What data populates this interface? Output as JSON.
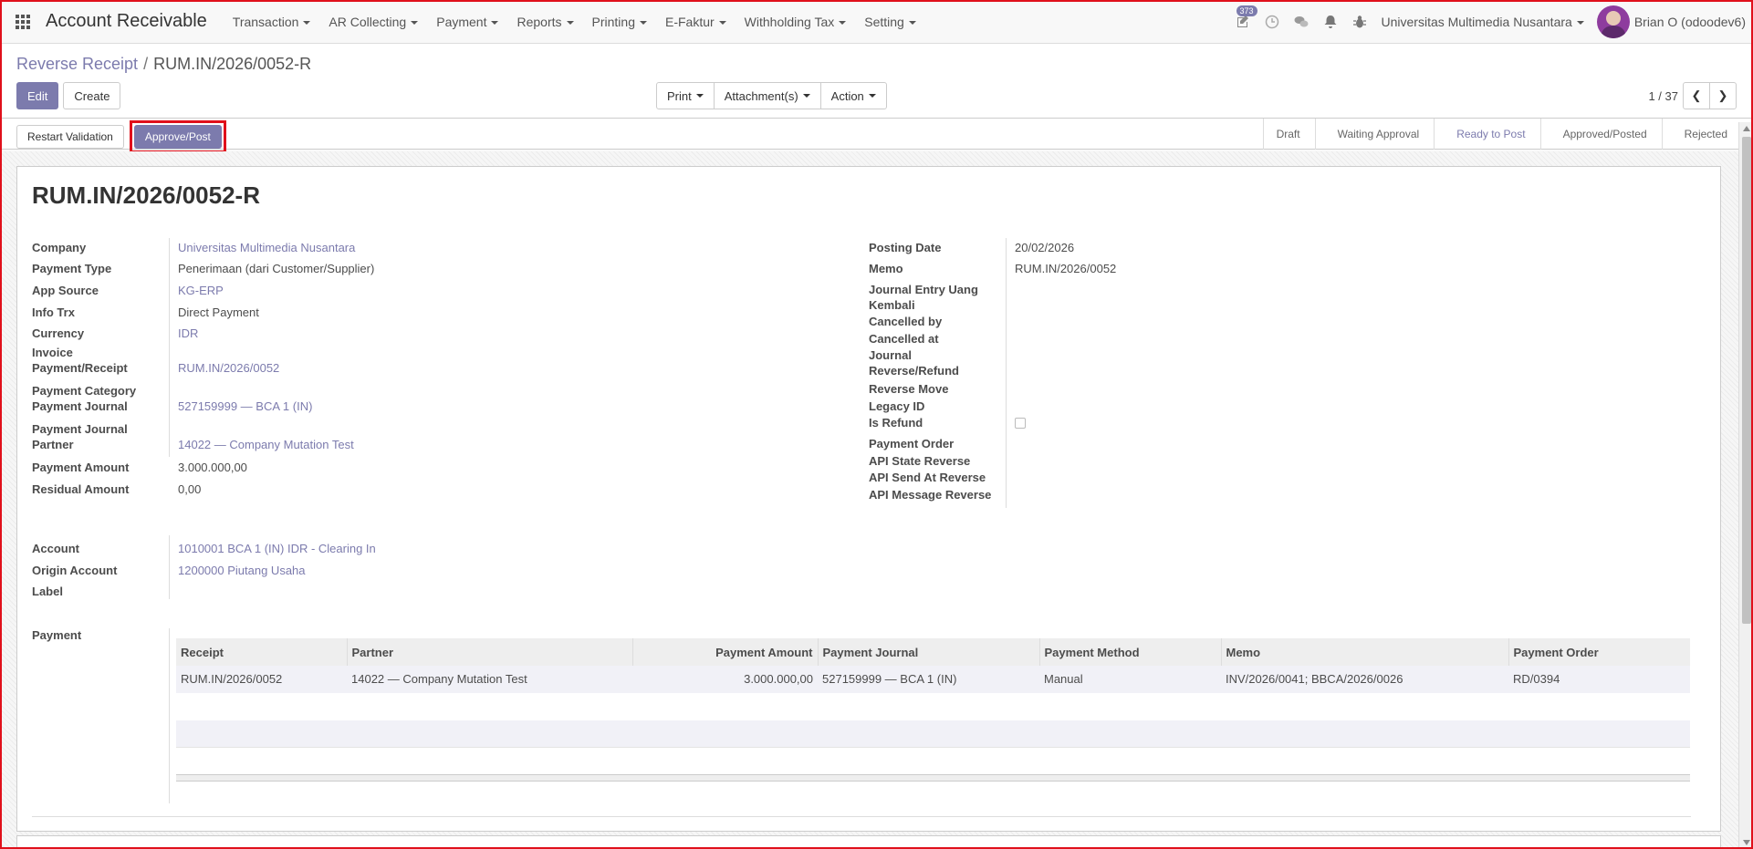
{
  "navbar": {
    "app_title": "Account Receivable",
    "menu": [
      "Transaction",
      "AR Collecting",
      "Payment",
      "Reports",
      "Printing",
      "E-Faktur",
      "Withholding Tax",
      "Setting"
    ],
    "activity_count": "373",
    "company": "Universitas Multimedia Nusantara",
    "user": "Brian O (odoodev6)"
  },
  "breadcrumb": {
    "parent": "Reverse Receipt",
    "current": "RUM.IN/2026/0052-R"
  },
  "control_panel": {
    "edit_label": "Edit",
    "create_label": "Create",
    "print_label": "Print",
    "attachments_label": "Attachment(s)",
    "action_label": "Action",
    "pager_value": "1 / 37"
  },
  "statusbar": {
    "restart_label": "Restart Validation",
    "approve_label": "Approve/Post",
    "states": [
      "Draft",
      "Waiting Approval",
      "Ready to Post",
      "Approved/Posted",
      "Rejected"
    ],
    "active_state": "Ready to Post"
  },
  "form": {
    "title": "RUM.IN/2026/0052-R",
    "left": {
      "company_label": "Company",
      "company": "Universitas Multimedia Nusantara",
      "payment_type_label": "Payment Type",
      "payment_type": "Penerimaan (dari Customer/Supplier)",
      "app_source_label": "App Source",
      "app_source": "KG-ERP",
      "info_trx_label": "Info Trx",
      "info_trx": "Direct Payment",
      "currency_label": "Currency",
      "currency": "IDR",
      "invoice_label_1": "Invoice",
      "invoice_label_2": "Payment/Receipt",
      "invoice": "RUM.IN/2026/0052",
      "payment_category_label": "Payment Category",
      "payment_journal_label": "Payment Journal",
      "payment_journal": "527159999 — BCA 1 (IN)",
      "payment_journal_partner_label_1": "Payment Journal",
      "payment_journal_partner_label_2": "Partner",
      "partner": "14022 — Company Mutation Test",
      "payment_amount_label": "Payment Amount",
      "payment_amount": "3.000.000,00",
      "residual_amount_label": "Residual Amount",
      "residual_amount": "0,00"
    },
    "right": {
      "posting_date_label": "Posting Date",
      "posting_date": "20/02/2026",
      "memo_label": "Memo",
      "memo": "RUM.IN/2026/0052",
      "je_label_1": "Journal Entry Uang",
      "je_label_2": "Kembali",
      "cancelled_by_label": "Cancelled by",
      "cancelled_at_label": "Cancelled at",
      "journal_label": "Journal",
      "reverse_refund_label": "Reverse/Refund",
      "reverse_move_label": "Reverse Move",
      "legacy_id_label": "Legacy ID",
      "is_refund_label": "Is Refund",
      "payment_order_label": "Payment Order",
      "api_state_label": "API State Reverse",
      "api_send_label": "API Send At Reverse",
      "api_message_label": "API Message Reverse"
    },
    "accounts": {
      "account_label": "Account",
      "account": "1010001 BCA 1 (IN) IDR - Clearing In",
      "origin_account_label": "Origin Account",
      "origin_account": "1200000 Piutang Usaha",
      "label_label": "Label"
    },
    "payment_section_label": "Payment",
    "payment_table": {
      "headers": [
        "Receipt",
        "Partner",
        "Payment Amount",
        "Payment Journal",
        "Payment Method",
        "Memo",
        "Payment Order"
      ],
      "rows": [
        [
          "RUM.IN/2026/0052",
          "14022 — Company Mutation Test",
          "3.000.000,00",
          "527159999 — BCA 1 (IN)",
          "Manual",
          "INV/2026/0041; BBCA/2026/0026",
          "RD/0394"
        ]
      ]
    }
  },
  "colors": {
    "accent": "#7c7bad",
    "highlight": "#e0101b"
  }
}
